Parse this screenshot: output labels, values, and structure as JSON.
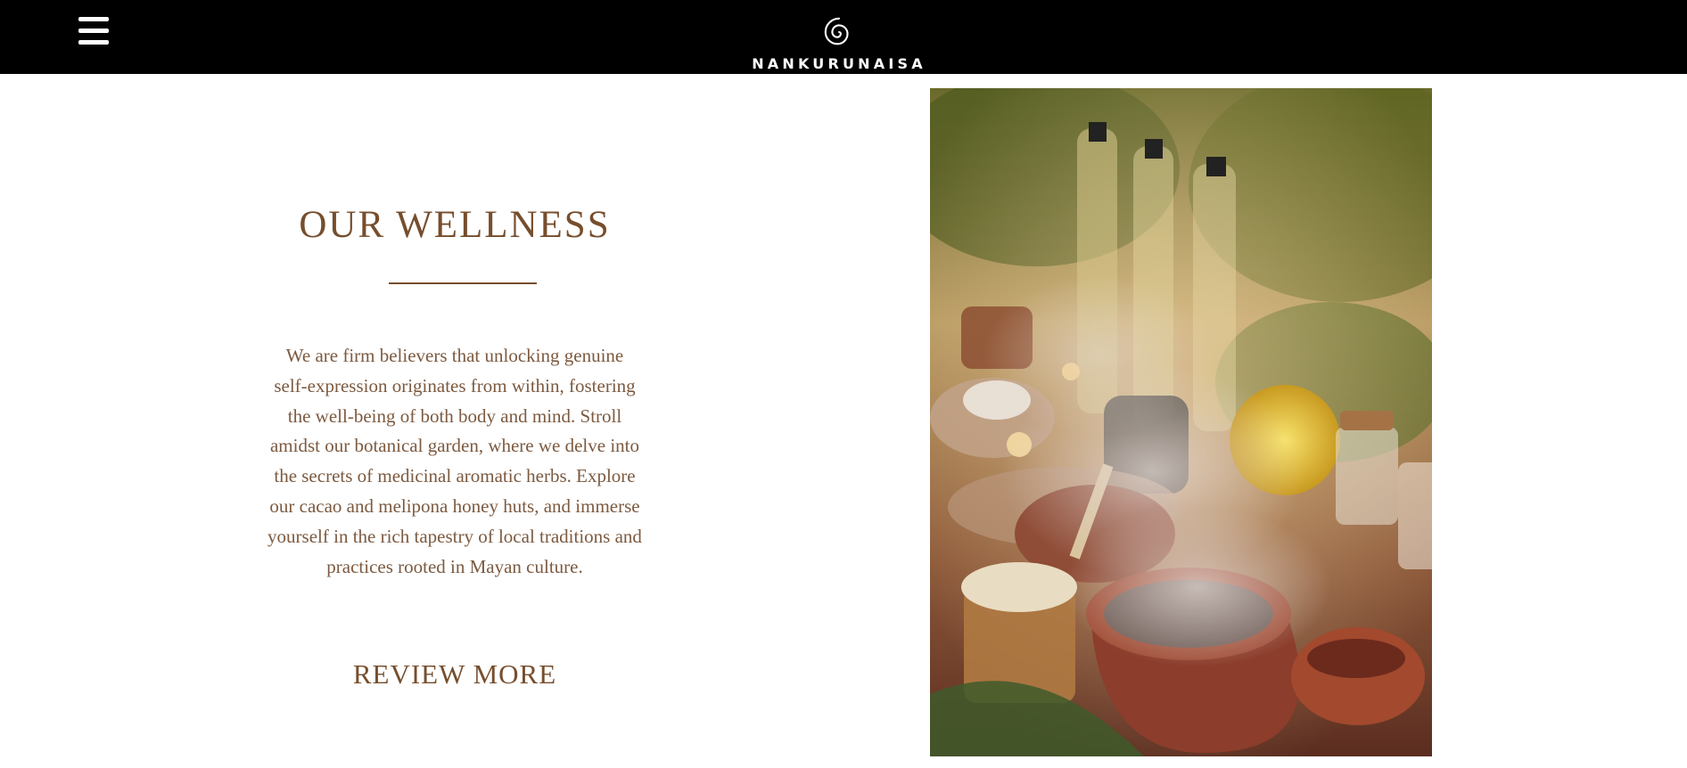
{
  "header": {
    "menu_icon": "hamburger-menu-icon",
    "logo_icon": "spiral-logo-icon",
    "brand_name": "NANKURUNAISA",
    "background": "#000000"
  },
  "section": {
    "title": "OUR WELLNESS",
    "body": "We are firm believers that unlocking genuine self-expression originates from within, fostering the well-being of both body and mind. Stroll amidst our botanical garden, where we delve into the secrets of medicinal aromatic herbs. Explore our cacao and melipona honey huts, and immerse yourself in the rich tapestry of local traditions and practices rooted in Mayan culture.",
    "cta_label": "REVIEW MORE",
    "accent_color": "#764e2d"
  }
}
